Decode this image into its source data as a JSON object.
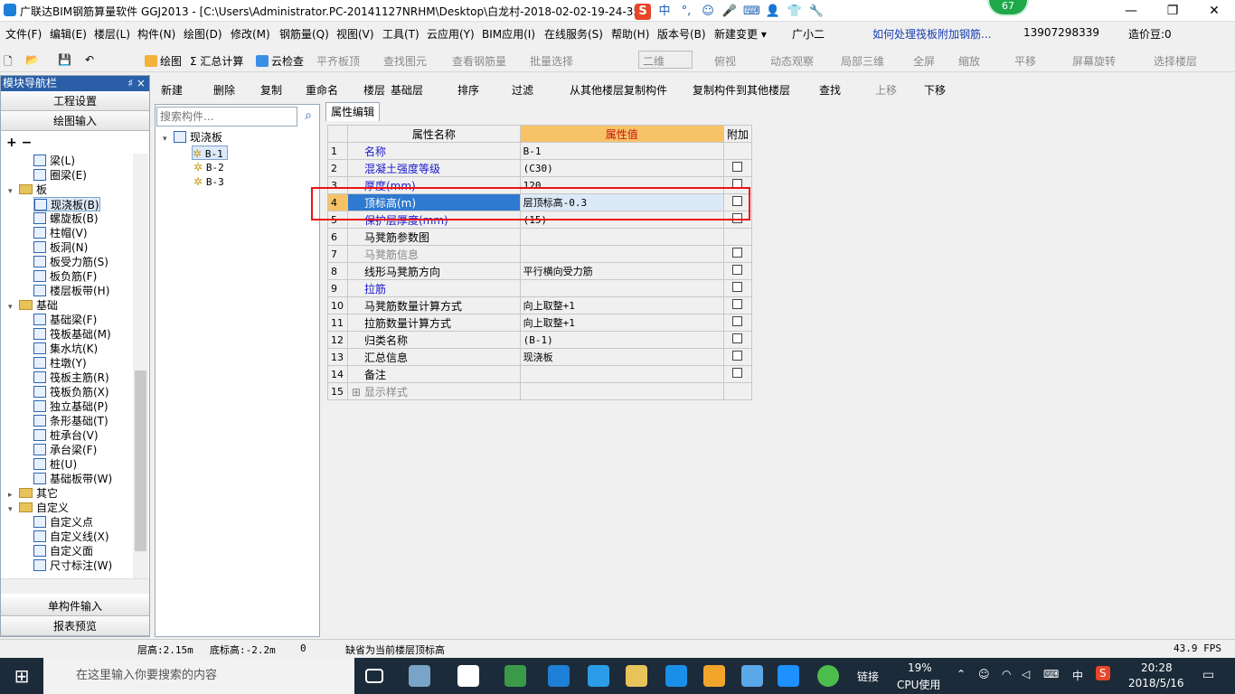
{
  "window": {
    "title": "广联达BIM钢筋算量软件 GGJ2013 - [C:\\Users\\Administrator.PC-20141127NRHM\\Desktop\\白龙村-2018-02-02-19-24-35",
    "minimize": "—",
    "restore": "❐",
    "close": "✕"
  },
  "ime": {
    "items": [
      "S",
      "中",
      "°,",
      "☺",
      "🎤",
      "⌨",
      "👤",
      "👕",
      "🔧"
    ]
  },
  "notification_badge": "67",
  "menu": {
    "items": [
      "文件(F)",
      "编辑(E)",
      "楼层(L)",
      "构件(N)",
      "绘图(D)",
      "修改(M)",
      "钢筋量(Q)",
      "视图(V)",
      "工具(T)",
      "云应用(Y)",
      "BIM应用(I)",
      "在线服务(S)",
      "帮助(H)",
      "版本号(B)",
      "新建变更 ▾",
      "广小二"
    ],
    "question_link": "如何处理筏板附加钢筋...",
    "phone": "13907298339",
    "price_beans": "造价豆:0"
  },
  "toolbar1": {
    "items": [
      "绘图",
      "Σ 汇总计算",
      "云检查",
      "平齐板顶",
      "查找图元",
      "查看钢筋量",
      "批量选择",
      "二维",
      "俯视",
      "动态观察",
      "局部三维",
      "全屏",
      "缩放",
      "平移",
      "屏幕旋转",
      "选择楼层"
    ]
  },
  "toolbar2": {
    "items": [
      "新建",
      "删除",
      "复制",
      "重命名",
      "楼层",
      "基础层",
      "排序",
      "过滤",
      "从其他楼层复制构件",
      "复制构件到其他楼层",
      "查找",
      "上移",
      "下移"
    ]
  },
  "left_panel": {
    "header": "模块导航栏",
    "pin": "♯ ×",
    "top_buttons": [
      "工程设置",
      "绘图输入"
    ],
    "tree_tools": "+  −",
    "tree": [
      {
        "label": "梁(L)",
        "level": 2,
        "type": "item"
      },
      {
        "label": "圈梁(E)",
        "level": 2,
        "type": "item"
      },
      {
        "label": "板",
        "level": 1,
        "type": "folder",
        "expanded": true
      },
      {
        "label": "现浇板(B)",
        "level": 2,
        "type": "item",
        "selected": true
      },
      {
        "label": "螺旋板(B)",
        "level": 2,
        "type": "item"
      },
      {
        "label": "柱帽(V)",
        "level": 2,
        "type": "item"
      },
      {
        "label": "板洞(N)",
        "level": 2,
        "type": "item"
      },
      {
        "label": "板受力筋(S)",
        "level": 2,
        "type": "item"
      },
      {
        "label": "板负筋(F)",
        "level": 2,
        "type": "item"
      },
      {
        "label": "楼层板带(H)",
        "level": 2,
        "type": "item"
      },
      {
        "label": "基础",
        "level": 1,
        "type": "folder",
        "expanded": true
      },
      {
        "label": "基础梁(F)",
        "level": 2,
        "type": "item"
      },
      {
        "label": "筏板基础(M)",
        "level": 2,
        "type": "item"
      },
      {
        "label": "集水坑(K)",
        "level": 2,
        "type": "item"
      },
      {
        "label": "柱墩(Y)",
        "level": 2,
        "type": "item"
      },
      {
        "label": "筏板主筋(R)",
        "level": 2,
        "type": "item"
      },
      {
        "label": "筏板负筋(X)",
        "level": 2,
        "type": "item"
      },
      {
        "label": "独立基础(P)",
        "level": 2,
        "type": "item"
      },
      {
        "label": "条形基础(T)",
        "level": 2,
        "type": "item"
      },
      {
        "label": "桩承台(V)",
        "level": 2,
        "type": "item"
      },
      {
        "label": "承台梁(F)",
        "level": 2,
        "type": "item"
      },
      {
        "label": "桩(U)",
        "level": 2,
        "type": "item"
      },
      {
        "label": "基础板带(W)",
        "level": 2,
        "type": "item"
      },
      {
        "label": "其它",
        "level": 1,
        "type": "folder",
        "expanded": false
      },
      {
        "label": "自定义",
        "level": 1,
        "type": "folder",
        "expanded": true
      },
      {
        "label": "自定义点",
        "level": 2,
        "type": "item"
      },
      {
        "label": "自定义线(X)",
        "level": 2,
        "type": "item"
      },
      {
        "label": "自定义面",
        "level": 2,
        "type": "item"
      },
      {
        "label": "尺寸标注(W)",
        "level": 2,
        "type": "item"
      }
    ],
    "bottom_buttons": [
      "单构件输入",
      "报表预览"
    ]
  },
  "component_list": {
    "search_placeholder": "搜索构件...",
    "root": "现浇板",
    "items": [
      "B-1",
      "B-2",
      "B-3"
    ],
    "selected": "B-1"
  },
  "property_editor": {
    "tab": "属性编辑",
    "headers": [
      "属性名称",
      "属性值",
      "附加"
    ],
    "rows": [
      {
        "num": "1",
        "name": "名称",
        "value": "B-1",
        "style": "blue",
        "check": false
      },
      {
        "num": "2",
        "name": "混凝土强度等级",
        "value": "(C30)",
        "style": "blue",
        "check": true
      },
      {
        "num": "3",
        "name": "厚度(mm)",
        "value": "120",
        "style": "blue",
        "check": true
      },
      {
        "num": "4",
        "name": "顶标高(m)",
        "value": "层顶标高-0.3",
        "style": "blue",
        "check": true,
        "highlight": true
      },
      {
        "num": "5",
        "name": "保护层厚度(mm)",
        "value": "(15)",
        "style": "blue",
        "check": true
      },
      {
        "num": "6",
        "name": "马凳筋参数图",
        "value": "",
        "style": "normal",
        "check": false
      },
      {
        "num": "7",
        "name": "马凳筋信息",
        "value": "",
        "style": "gray",
        "check": true
      },
      {
        "num": "8",
        "name": "线形马凳筋方向",
        "value": "平行横向受力筋",
        "style": "normal",
        "check": true
      },
      {
        "num": "9",
        "name": "拉筋",
        "value": "",
        "style": "blue",
        "check": true
      },
      {
        "num": "10",
        "name": "马凳筋数量计算方式",
        "value": "向上取整+1",
        "style": "normal",
        "check": true
      },
      {
        "num": "11",
        "name": "拉筋数量计算方式",
        "value": "向上取整+1",
        "style": "normal",
        "check": true
      },
      {
        "num": "12",
        "name": "归类名称",
        "value": "(B-1)",
        "style": "normal",
        "check": true
      },
      {
        "num": "13",
        "name": "汇总信息",
        "value": "现浇板",
        "style": "normal",
        "check": true
      },
      {
        "num": "14",
        "name": "备注",
        "value": "",
        "style": "normal",
        "check": true
      },
      {
        "num": "15",
        "name": "显示样式",
        "value": "",
        "style": "gray",
        "check": false,
        "expandable": true
      }
    ]
  },
  "status_bar": {
    "floor_height": "层高:2.15m",
    "bottom_elev": "底标高:-2.2m",
    "zero": "0",
    "hint": "缺省为当前楼层顶标高",
    "fps": "43.9 FPS"
  },
  "taskbar": {
    "search_placeholder": "在这里输入你要搜索的内容",
    "link": "链接",
    "cpu_percent": "19%",
    "cpu_label": "CPU使用",
    "lang": "中",
    "time": "20:28",
    "date": "2018/5/16"
  }
}
